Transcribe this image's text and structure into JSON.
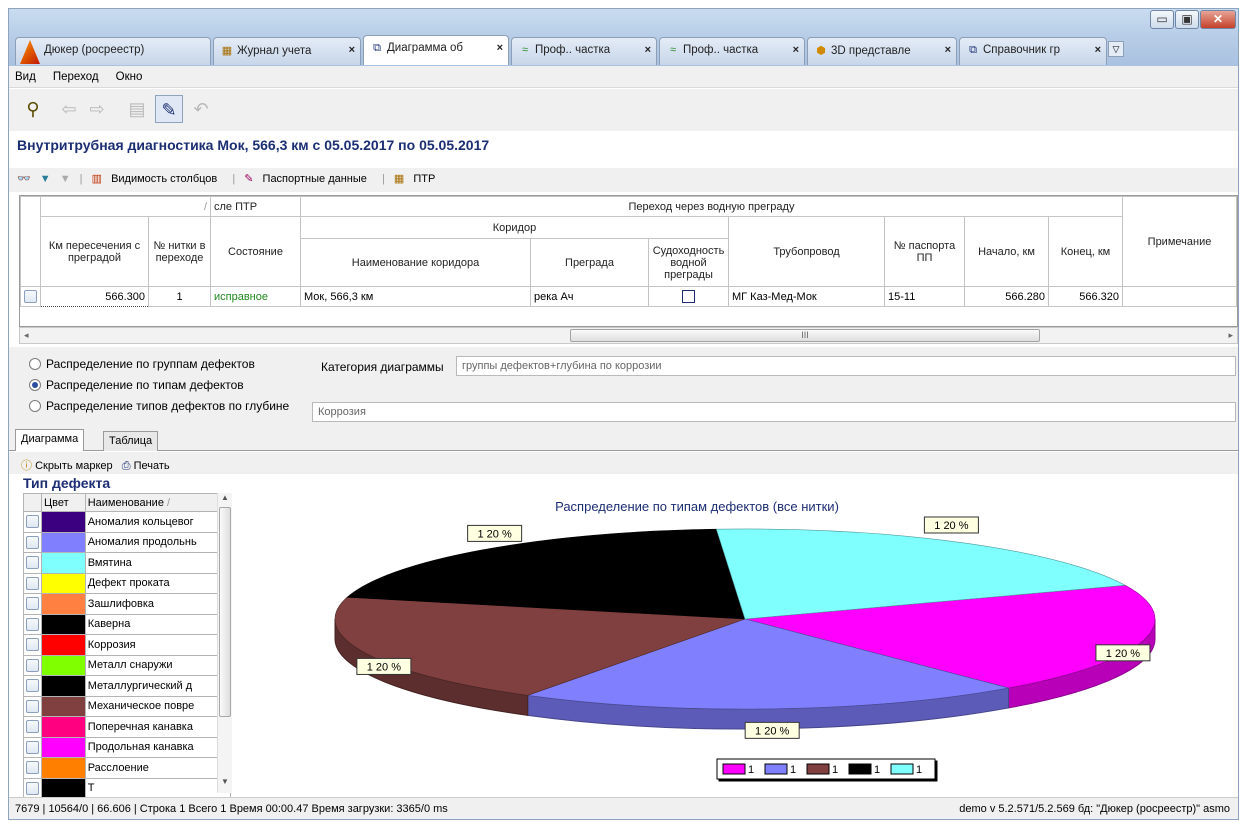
{
  "tabs": [
    {
      "label": "Дюкер (росреестр)",
      "icon": "app-logo-icon",
      "active": false,
      "closable": false
    },
    {
      "label": "Журнал учета",
      "icon": "journal-icon",
      "active": false,
      "closable": true
    },
    {
      "label": "Диаграмма об",
      "icon": "document-icon",
      "active": true,
      "closable": true
    },
    {
      "label": "Проф.. частка",
      "icon": "profile-icon",
      "active": false,
      "closable": true
    },
    {
      "label": "Проф.. частка",
      "icon": "profile-icon",
      "active": false,
      "closable": true
    },
    {
      "label": "3D представле",
      "icon": "cube-3d-icon",
      "active": false,
      "closable": true
    },
    {
      "label": "Справочник гр",
      "icon": "document-icon",
      "active": false,
      "closable": true
    }
  ],
  "menu": {
    "items": [
      "Вид",
      "Переход",
      "Окно"
    ]
  },
  "heading": "Внутритрубная диагностика Мок, 566,3 км с 05.05.2017 по 05.05.2017",
  "grid_toolbar": {
    "columns_visibility": "Видимость столбцов",
    "passport_data": "Паспортные данные",
    "ptr": "ПТР"
  },
  "grid": {
    "group_after_ptr": "сле ПТР",
    "group_crossing": "Переход через водную преграду",
    "group_corridor": "Коридор",
    "headers": {
      "km": "Км пересечения с преградой",
      "thread": "№ нитки в переходе",
      "state": "Состояние",
      "corridor_name": "Наименование коридора",
      "obstacle": "Преграда",
      "navigability": "Судоходность водной преграды",
      "pipeline": "Трубопровод",
      "passport": "№ паспорта ПП",
      "start": "Начало, км",
      "end": "Конец, км",
      "note": "Примечание"
    },
    "row": {
      "km": "566.300",
      "thread": "1",
      "state": "исправное",
      "corridor_name": "Мок, 566,3 км",
      "obstacle": "река Ач",
      "pipeline": "МГ Каз-Мед-Мок",
      "passport": "15-11",
      "start": "566.280",
      "end": "566.320",
      "note": ""
    },
    "scroll_mark": "III"
  },
  "filters": {
    "radios": [
      {
        "label": "Распределение по группам дефектов",
        "checked": false
      },
      {
        "label": "Распределение по типам дефектов",
        "checked": true
      },
      {
        "label": "Распределение типов дефектов по глубине",
        "checked": false
      }
    ],
    "category_label": "Категория диаграммы",
    "category_value": "группы дефектов+глубина по коррозии",
    "depth_value": "Коррозия"
  },
  "subtabs": [
    "Диаграмма",
    "Таблица"
  ],
  "chart_toolbar": {
    "hide_marker": "Скрыть маркер",
    "print": "Печать"
  },
  "legend_panel": {
    "title": "Тип дефекта",
    "col_color": "Цвет",
    "col_name": "Наименование",
    "items": [
      {
        "color": "#3a0080",
        "name": "Аномалия кольцевог"
      },
      {
        "color": "#8080ff",
        "name": "Аномалия продольнь"
      },
      {
        "color": "#80ffff",
        "name": "Вмятина"
      },
      {
        "color": "#ffff00",
        "name": "Дефект проката"
      },
      {
        "color": "#ff8040",
        "name": "Зашлифовка"
      },
      {
        "color": "#000000",
        "name": "Каверна"
      },
      {
        "color": "#ff0000",
        "name": "Коррозия"
      },
      {
        "color": "#80ff00",
        "name": "Металл снаружи"
      },
      {
        "color": "#000000",
        "name": "Металлургический д"
      },
      {
        "color": "#804040",
        "name": "Механическое повре"
      },
      {
        "color": "#ff0080",
        "name": "Поперечная канавка"
      },
      {
        "color": "#ff00ff",
        "name": "Продольная канавка"
      },
      {
        "color": "#ff8000",
        "name": "Расслоение"
      },
      {
        "color": "#000000",
        "name": "Т"
      }
    ]
  },
  "chart_data": {
    "type": "pie",
    "title": "Распределение по типам дефектов (все нитки)",
    "slices": [
      {
        "name": "1",
        "value": 1,
        "label": "1 20 %",
        "color": "#ff00ff"
      },
      {
        "name": "1",
        "value": 1,
        "label": "1 20 %",
        "color": "#8080ff"
      },
      {
        "name": "1",
        "value": 1,
        "label": "1 20 %",
        "color": "#804040"
      },
      {
        "name": "1",
        "value": 1,
        "label": "1 20 %",
        "color": "#000000"
      },
      {
        "name": "1",
        "value": 1,
        "label": "1 20 %",
        "color": "#80ffff"
      }
    ],
    "legend_position": "bottom"
  },
  "status": {
    "left": "7679   |   10564/0   |   66.606   |   Строка 1 Всего 1 Время 00:00.47   Время загрузки: 3365/0 ms",
    "right": "demo  v 5.2.571/5.2.569  бд: \"Дюкер (росреестр)\" asmo"
  }
}
